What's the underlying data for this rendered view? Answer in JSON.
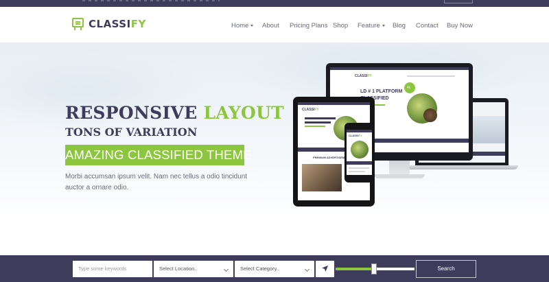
{
  "brand": {
    "logo_part1": "CLASSI",
    "logo_part2": "FY",
    "accent": "#8cc63f",
    "dark": "#3e3b5b"
  },
  "nav": {
    "items": [
      {
        "label": "Home",
        "dropdown": true
      },
      {
        "label": "About",
        "dropdown": false
      },
      {
        "label": "Pricing Plans",
        "dropdown": false
      },
      {
        "label": "Shop",
        "dropdown": false
      },
      {
        "label": "Feature",
        "dropdown": true
      },
      {
        "label": "Blog",
        "dropdown": false
      },
      {
        "label": "Contact",
        "dropdown": false
      },
      {
        "label": "Buy Now",
        "dropdown": false
      }
    ]
  },
  "hero": {
    "title_part1": "RESPONSIVE",
    "title_part2": "LAYOUT",
    "subtitle": "TONS OF VARIATION",
    "banner": "AMAZING CLASSIFIED THEME",
    "description": "Morbi accumsan ipsum velit. Nam nec tellus a odio tincidunt auctor a ornare odio."
  },
  "mockup": {
    "monitor_heading_1": "LD # 1 PLATFORM",
    "monitor_heading_2": "CLASSIFIED",
    "tablet_heading": "PREMIUM ADVERTISEMENT",
    "badge": "4c"
  },
  "search": {
    "keyword_placeholder": "Type some keywords",
    "location_value": "Select Location..",
    "category_value": "Select Category..",
    "slider_level_fraction": 0.49,
    "button_label": "Search",
    "location_icon": "location-arrow-icon"
  }
}
